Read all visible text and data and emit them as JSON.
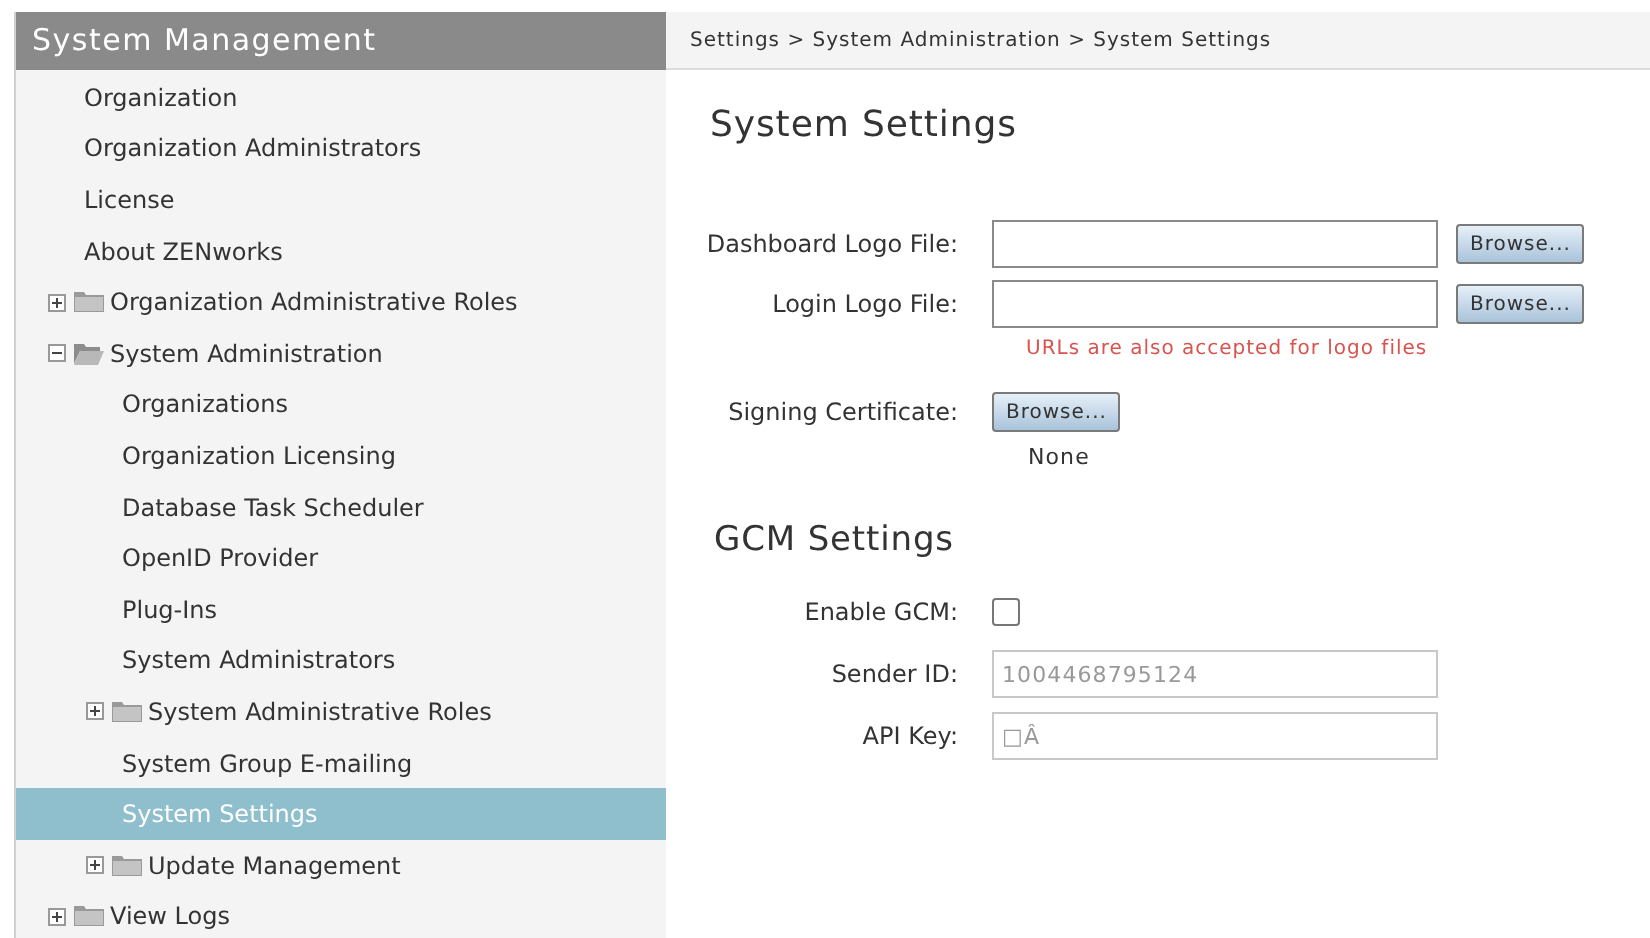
{
  "sidebar": {
    "title": "System Management",
    "items": [
      {
        "kind": "leaf",
        "label": "Organization",
        "selected": false
      },
      {
        "kind": "leaf",
        "label": "Organization Administrators",
        "selected": false
      },
      {
        "kind": "leaf",
        "label": "License",
        "selected": false
      },
      {
        "kind": "leaf",
        "label": "About ZENworks",
        "selected": false
      },
      {
        "kind": "folder",
        "label": "Organization Administrative Roles",
        "expanded": false,
        "selected": false
      },
      {
        "kind": "folder",
        "label": "System Administration",
        "expanded": true,
        "selected": false,
        "children": [
          {
            "kind": "leaf",
            "label": "Organizations",
            "selected": false
          },
          {
            "kind": "leaf",
            "label": "Organization Licensing",
            "selected": false
          },
          {
            "kind": "leaf",
            "label": "Database Task Scheduler",
            "selected": false
          },
          {
            "kind": "leaf",
            "label": "OpenID Provider",
            "selected": false
          },
          {
            "kind": "leaf",
            "label": "Plug-Ins",
            "selected": false
          },
          {
            "kind": "leaf",
            "label": "System Administrators",
            "selected": false
          },
          {
            "kind": "folder",
            "label": "System Administrative Roles",
            "expanded": false,
            "selected": false
          },
          {
            "kind": "leaf",
            "label": "System Group E-mailing",
            "selected": false
          },
          {
            "kind": "leaf",
            "label": "System Settings",
            "selected": true
          },
          {
            "kind": "folder",
            "label": "Update Management",
            "expanded": false,
            "selected": false
          }
        ]
      },
      {
        "kind": "folder",
        "label": "View Logs",
        "expanded": false,
        "selected": false
      }
    ]
  },
  "breadcrumb": "Settings > System Administration > System Settings",
  "page_title": "System Settings",
  "logo_fields": [
    {
      "kind": "file",
      "label": "Dashboard Logo File:",
      "button": "Browse..."
    },
    {
      "kind": "file",
      "label": "Login Logo File:",
      "button": "Browse...",
      "hint": "URLs are also accepted for logo files"
    },
    {
      "kind": "browse",
      "label": "Signing Certificate:",
      "button": "Browse...",
      "note": "None"
    }
  ],
  "gcm": {
    "title": "GCM Settings",
    "fields": [
      {
        "kind": "checkbox",
        "label": "Enable GCM:",
        "checked": false
      },
      {
        "kind": "text",
        "label": "Sender ID:",
        "value": "1004468795124",
        "disabled": true
      },
      {
        "kind": "text",
        "label": "API Key:",
        "value": "□Â",
        "disabled": true
      }
    ]
  }
}
